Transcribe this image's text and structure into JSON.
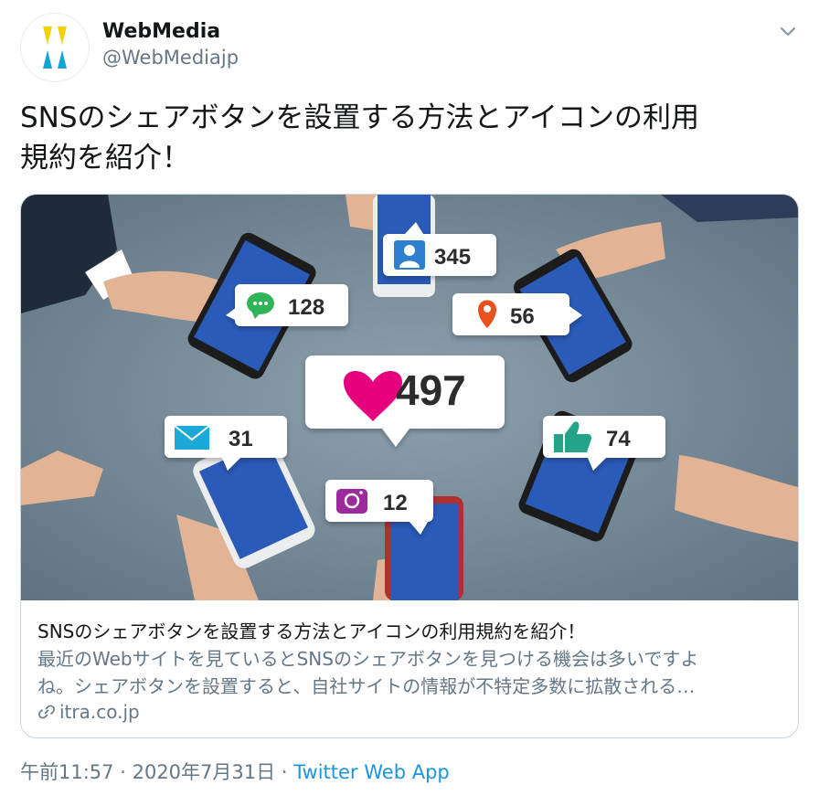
{
  "tweet": {
    "author": {
      "name": "WebMedia",
      "handle": "@WebMediajp"
    },
    "text_line1": "SNSのシェアボタンを設置する方法とアイコンの利用",
    "text_line2": "規約を紹介！",
    "time": "午前11:57",
    "date": "2020年7月31日",
    "separator": "·",
    "source": "Twitter Web App"
  },
  "card": {
    "title": "SNSのシェアボタンを設置する方法とアイコンの利用規約を紹介！",
    "desc_line1": "最近のWebサイトを見ているとSNSのシェアボタンを見つける機会は多いですよ",
    "desc_line2": "ね。シェアボタンを設置すると、自社サイトの情報が不特定多数に拡散される…",
    "domain": "itra.co.jp",
    "counters": {
      "likes": "497",
      "followers": "345",
      "comments": "128",
      "location": "56",
      "mail": "31",
      "thumbs": "74",
      "photo": "12"
    }
  },
  "colors": {
    "link": "#1b95e0",
    "secondary": "#657786",
    "heart": "#e6007e",
    "bubble_green": "#2fb457",
    "pin_orange": "#e8511c",
    "mail_blue": "#1da9d8",
    "thumb_teal": "#23a489",
    "camera_purple": "#9b2a9b",
    "person_blue": "#2f7fd1"
  }
}
